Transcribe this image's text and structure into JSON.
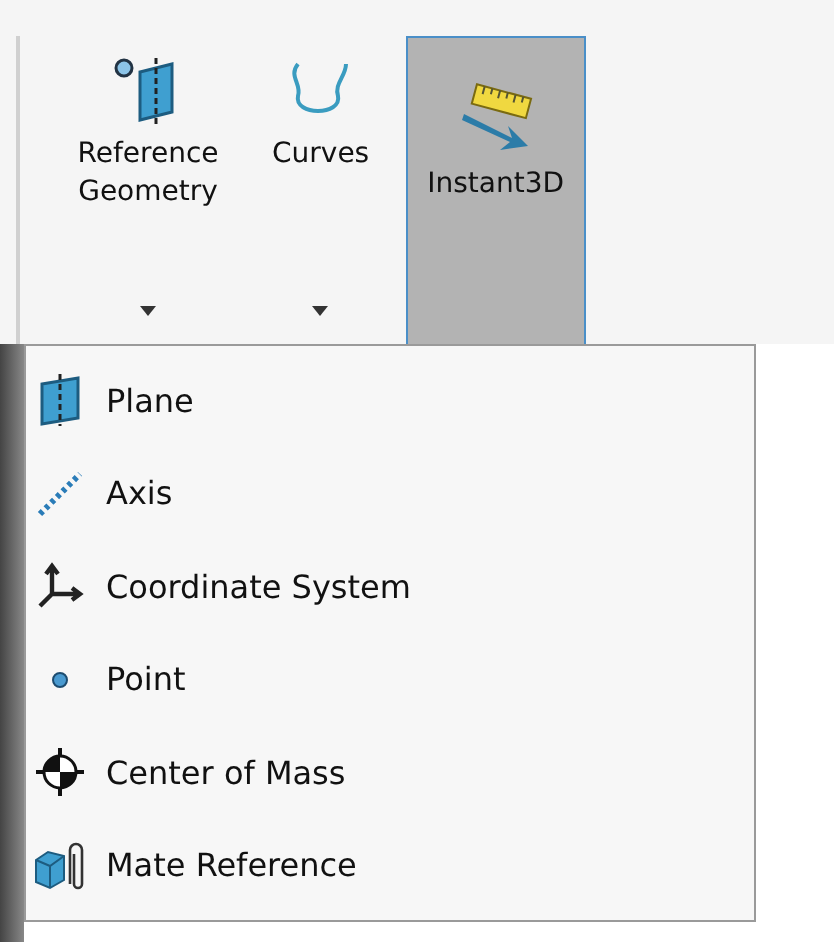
{
  "ribbon": {
    "buttons": [
      {
        "label": "Reference Geometry",
        "has_dropdown": true,
        "selected": false
      },
      {
        "label": "Curves",
        "has_dropdown": true,
        "selected": false
      },
      {
        "label": "Instant3D",
        "has_dropdown": false,
        "selected": true
      }
    ]
  },
  "menu": {
    "items": [
      {
        "label": "Plane"
      },
      {
        "label": "Axis"
      },
      {
        "label": "Coordinate System"
      },
      {
        "label": "Point"
      },
      {
        "label": "Center of Mass"
      },
      {
        "label": "Mate Reference"
      }
    ]
  }
}
